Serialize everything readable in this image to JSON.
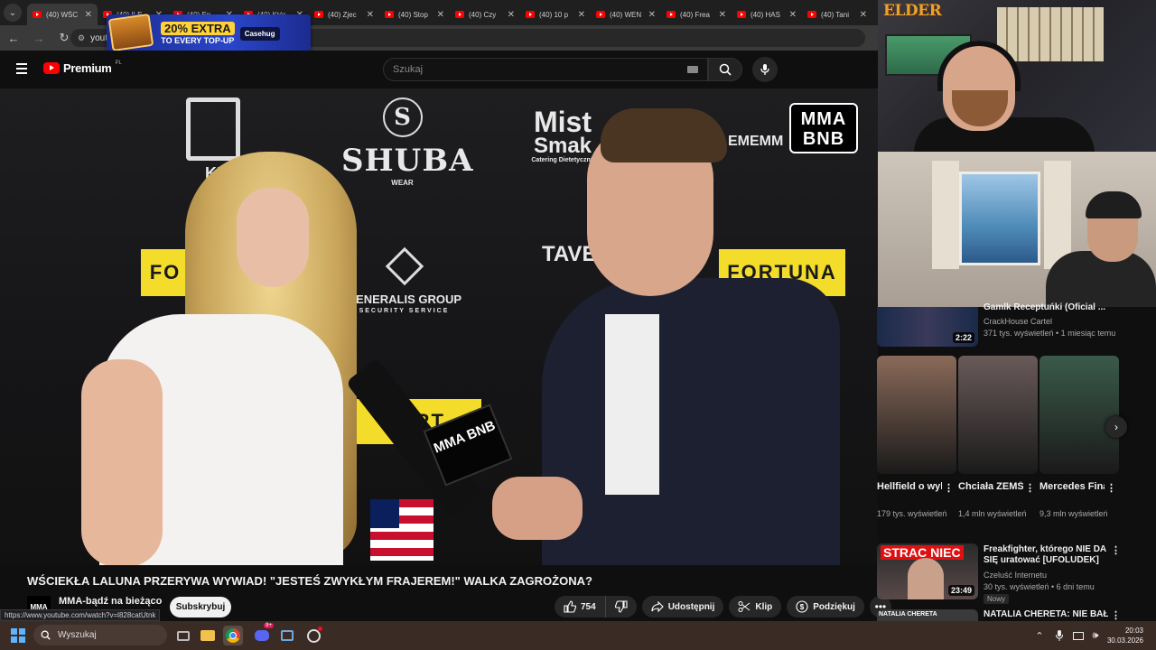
{
  "browser": {
    "tabs": [
      {
        "title": "(40) WŚC",
        "active": true
      },
      {
        "title": "(40) ILE",
        "active": false
      },
      {
        "title": "(40) Ep.",
        "active": false
      },
      {
        "title": "(40) Któr",
        "active": false
      },
      {
        "title": "(40) Zjec",
        "active": false
      },
      {
        "title": "(40) Stop",
        "active": false
      },
      {
        "title": "(40) Czy",
        "active": false
      },
      {
        "title": "(40) 10 p",
        "active": false
      },
      {
        "title": "(40) WEN",
        "active": false
      },
      {
        "title": "(40) Frea",
        "active": false
      },
      {
        "title": "(40) HAS",
        "active": false
      },
      {
        "title": "(40) Tani",
        "active": false
      }
    ],
    "url_display": "yout",
    "status_url": "https://www.youtube.com/watch?v=l828catUtnk"
  },
  "ad": {
    "headline": "20% EXTRA",
    "subline": "TO EVERY TOP-UP",
    "brand": "Casehug"
  },
  "youtube": {
    "logo_text": "Premium",
    "region": "PL",
    "search_placeholder": "Szukaj"
  },
  "video": {
    "overlay_brand": "MMA BNB",
    "sponsors": [
      "SHUBA",
      "WEAR",
      "GENERALIS GROUP",
      "SECURITY SERVICE",
      "Mist",
      "Smak",
      "Catering Dietetyczny",
      "FORTUNA",
      "TAVE",
      "EMEMM",
      "KI",
      "FO",
      "FORT"
    ],
    "mic_brand": "MMA BNB",
    "title": "WŚCIEKŁA LALUNA PRZERYWA WYWIAD! \"JESTEŚ ZWYKŁYM FRAJEREM!\" WALKA ZAGROŻONA?",
    "channel_name": "MMA-bądź na bieżąco",
    "channel_avatar": "MMA",
    "subscribe_label": "Subskrybuj",
    "likes": "754",
    "share_label": "Udostępnij",
    "clip_label": "Klip",
    "thanks_label": "Podziękuj"
  },
  "stream_overlay": {
    "logo": "ELDER"
  },
  "recommendations": {
    "cut_item": {
      "title": "Gamlk Receptuńki (Oficial ...",
      "channel": "CrackHouse Cartel",
      "meta": "371 tys. wyświetleń • 1 miesiąc temu",
      "duration": "2:22"
    },
    "shorts": [
      {
        "title": "Hellfield o wykształce...",
        "views": "179 tys. wyświetleń",
        "color": "#8a6a5a"
      },
      {
        "title": "Chciała ZEMŚCIĆ S...",
        "views": "1,4 mln wyświetleń",
        "color": "#6a5a5a"
      },
      {
        "title": "Mercedes Final Boss ...",
        "views": "9,3 mln wyświetleń",
        "color": "#3a5a4a"
      }
    ],
    "video1": {
      "title": "Freakfighter, którego NIE DA SIĘ uratować [UFOLUDEK]",
      "channel": "Czeluść Internetu",
      "meta": "30 tys. wyświetleń • 6 dni temu",
      "badge": "Nowy",
      "duration": "23:49",
      "thumb_text": "STRAC NIEC"
    },
    "video2": {
      "title": "NATALIA CHERETA: NIE BAŁAM",
      "thumb_text": "NATALIA CHERETA"
    }
  },
  "taskbar": {
    "search_placeholder": "Wyszukaj",
    "time": "20:03",
    "date": "30.03.2026",
    "discord_badge": "9+"
  }
}
